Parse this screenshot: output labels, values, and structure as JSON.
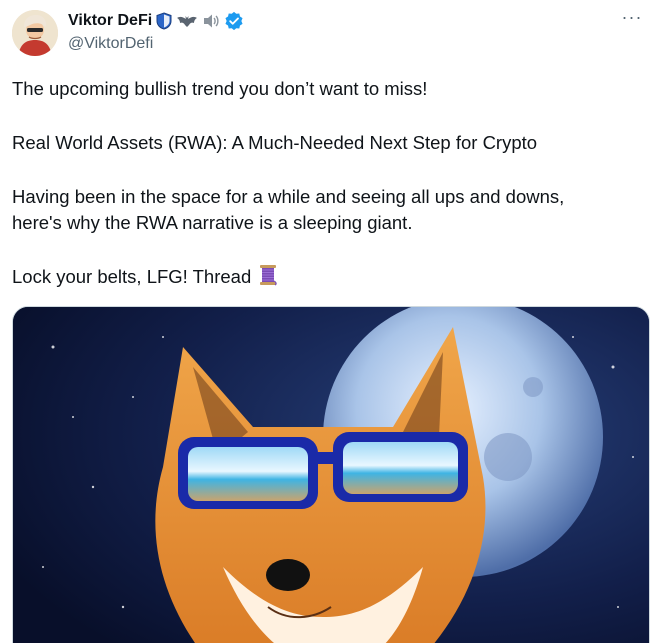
{
  "author": {
    "display_name": "Viktor DeFi",
    "handle": "@ViktorDefi",
    "verified": true,
    "name_emojis": [
      "shield-icon",
      "bat-icon",
      "speaker-icon"
    ]
  },
  "tweet": {
    "lines": [
      "The upcoming bullish trend you don’t want to miss!",
      "Real World Assets (RWA): A Much-Needed Next Step for Crypto",
      "Having been in the space for a while and seeing all ups and downs,",
      "here's why the RWA narrative is a sleeping giant.",
      "Lock your belts, LFG! Thread"
    ],
    "thread_emoji": "spool-of-thread-icon"
  },
  "colors": {
    "text": "#0f1419",
    "secondary": "#536471",
    "verified_blue": "#1d9bf0",
    "border": "#cfd9de"
  },
  "icons": {
    "more": "more-options-icon"
  }
}
